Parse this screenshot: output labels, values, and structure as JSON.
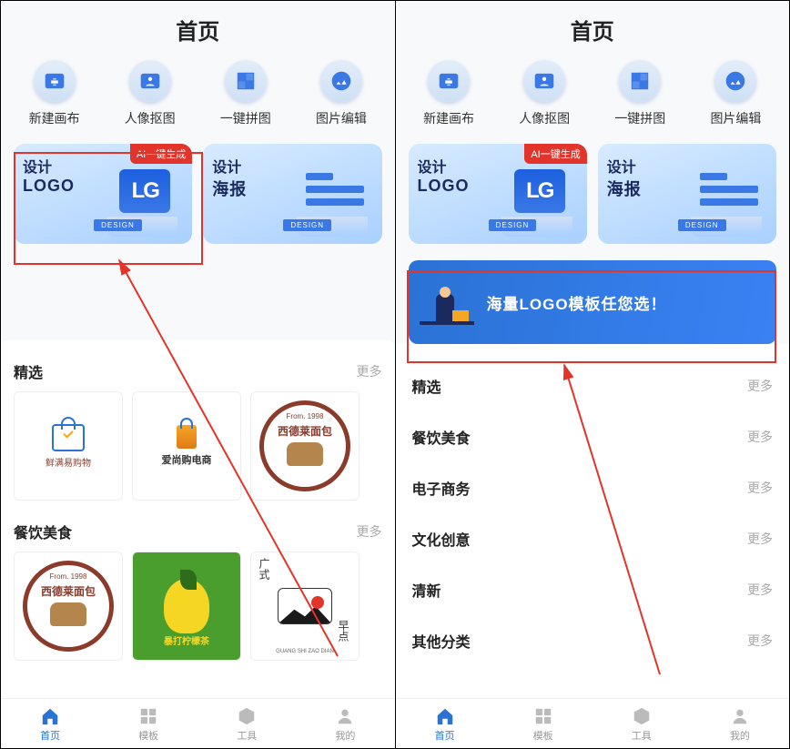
{
  "left": {
    "title": "首页",
    "icons": [
      {
        "label": "新建画布"
      },
      {
        "label": "人像抠图"
      },
      {
        "label": "一键拼图"
      },
      {
        "label": "图片编辑"
      }
    ],
    "card_logo": {
      "t1": "设计",
      "t2": "LOGO",
      "badge": "AI一键生成",
      "tag": "DESIGN"
    },
    "card_poster": {
      "t1": "设计",
      "t2": "海报",
      "tag": "DESIGN"
    },
    "sec1": {
      "title": "精选",
      "more": "更多"
    },
    "sec1_thumbs": [
      {
        "text": "鲜满易购物"
      },
      {
        "text": "爱尚购电商"
      },
      {
        "from": "From. 1998",
        "name": "西德莱面包"
      }
    ],
    "sec2": {
      "title": "餐饮美食",
      "more": "更多"
    },
    "sec2_thumbs": [
      {
        "from": "From. 1998",
        "name": "西德莱面包"
      },
      {
        "text": "暴打柠檬茶"
      },
      {
        "text1": "广式",
        "text2": "早点",
        "sub": "GUANG SHI ZAO DIAN"
      }
    ]
  },
  "right": {
    "title": "首页",
    "icons": [
      {
        "label": "新建画布"
      },
      {
        "label": "人像抠图"
      },
      {
        "label": "一键拼图"
      },
      {
        "label": "图片编辑"
      }
    ],
    "card_logo": {
      "t1": "设计",
      "t2": "LOGO",
      "badge": "AI一键生成",
      "tag": "DESIGN"
    },
    "card_poster": {
      "t1": "设计",
      "t2": "海报",
      "tag": "DESIGN"
    },
    "banner": "海量LOGO模板任您选！",
    "categories": [
      {
        "name": "精选",
        "more": "更多"
      },
      {
        "name": "餐饮美食",
        "more": "更多"
      },
      {
        "name": "电子商务",
        "more": "更多"
      },
      {
        "name": "文化创意",
        "more": "更多"
      },
      {
        "name": "清新",
        "more": "更多"
      },
      {
        "name": "其他分类",
        "more": "更多"
      }
    ]
  },
  "nav": [
    {
      "label": "首页"
    },
    {
      "label": "模板"
    },
    {
      "label": "工具"
    },
    {
      "label": "我的"
    }
  ]
}
